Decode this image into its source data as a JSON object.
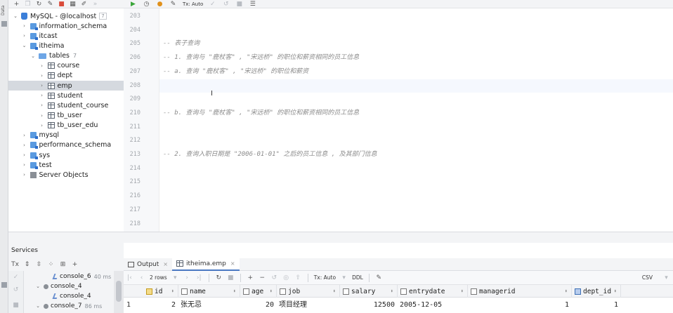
{
  "app": {
    "strip_label": "Data",
    "tree_toolbar_icons": [
      "add-icon",
      "copy-icon",
      "refresh-icon",
      "properties-icon",
      "stop-icon",
      "table-icon",
      "edit-icon",
      "back-icon"
    ],
    "editor_toolbar": {
      "tx_label": "Tx: Auto"
    }
  },
  "tree": [
    {
      "label": "MySQL - @localhost",
      "count": "7",
      "kind": "datasource",
      "expanded": true,
      "depth": 0
    },
    {
      "label": "information_schema",
      "kind": "schema",
      "expanded": false,
      "depth": 1
    },
    {
      "label": "itcast",
      "kind": "schema",
      "expanded": false,
      "depth": 1
    },
    {
      "label": "itheima",
      "kind": "schema",
      "expanded": true,
      "depth": 1
    },
    {
      "label": "tables",
      "count": "7",
      "kind": "folder",
      "expanded": true,
      "depth": 2
    },
    {
      "label": "course",
      "kind": "table",
      "depth": 3
    },
    {
      "label": "dept",
      "kind": "table",
      "depth": 3
    },
    {
      "label": "emp",
      "kind": "table",
      "depth": 3,
      "selected": true
    },
    {
      "label": "student",
      "kind": "table",
      "depth": 3
    },
    {
      "label": "student_course",
      "kind": "table",
      "depth": 3
    },
    {
      "label": "tb_user",
      "kind": "table",
      "depth": 3
    },
    {
      "label": "tb_user_edu",
      "kind": "table",
      "depth": 3
    },
    {
      "label": "mysql",
      "kind": "schema",
      "expanded": false,
      "depth": 1
    },
    {
      "label": "performance_schema",
      "kind": "schema",
      "expanded": false,
      "depth": 1
    },
    {
      "label": "sys",
      "kind": "schema",
      "expanded": false,
      "depth": 1
    },
    {
      "label": "test",
      "kind": "schema",
      "expanded": false,
      "depth": 1
    },
    {
      "label": "Server Objects",
      "kind": "server",
      "expanded": false,
      "depth": 1
    }
  ],
  "editor": {
    "lines": [
      {
        "number": "203",
        "text": ""
      },
      {
        "number": "204",
        "text": ""
      },
      {
        "number": "205",
        "text": "-- 表子查询"
      },
      {
        "number": "206",
        "text": "-- 1. 查询与 \"鹿杖客\" , \"宋远桥\" 的职位和薪资相同的员工信息"
      },
      {
        "number": "207",
        "text": "-- a. 查询 \"鹿杖客\" , \"宋远桥\" 的职位和薪资"
      },
      {
        "number": "208",
        "text": "",
        "current": true
      },
      {
        "number": "209",
        "text": ""
      },
      {
        "number": "210",
        "text": "-- b. 查询与 \"鹿杖客\" , \"宋远桥\" 的职位和薪资相同的员工信息"
      },
      {
        "number": "211",
        "text": ""
      },
      {
        "number": "212",
        "text": ""
      },
      {
        "number": "213",
        "text": "-- 2. 查询入职日期是 \"2006-01-01\" 之后的员工信息 , 及其部门信息"
      },
      {
        "number": "214",
        "text": ""
      },
      {
        "number": "215",
        "text": ""
      },
      {
        "number": "216",
        "text": ""
      },
      {
        "number": "217",
        "text": ""
      },
      {
        "number": "218",
        "text": ""
      }
    ]
  },
  "services": {
    "title": "Services",
    "tx_label": "Tx",
    "items": [
      {
        "label": "console_6",
        "ms": "40 ms",
        "kind": "console"
      },
      {
        "label": "console_4",
        "kind": "session"
      },
      {
        "label": "console_4",
        "kind": "console"
      },
      {
        "label": "console_7",
        "ms": "86 ms",
        "kind": "session"
      }
    ]
  },
  "results": {
    "tabs": [
      {
        "label": "Output",
        "active": false
      },
      {
        "label": "itheima.emp",
        "active": true
      }
    ],
    "rows_label": "2 rows",
    "tx_label": "Tx: Auto",
    "ddl_label": "DDL",
    "csv_label": "CSV",
    "columns": [
      {
        "name": "id",
        "kind": "key"
      },
      {
        "name": "name",
        "kind": "col"
      },
      {
        "name": "age",
        "kind": "col"
      },
      {
        "name": "job",
        "kind": "col"
      },
      {
        "name": "salary",
        "kind": "col"
      },
      {
        "name": "entrydate",
        "kind": "col"
      },
      {
        "name": "managerid",
        "kind": "col"
      },
      {
        "name": "dept_id",
        "kind": "fk"
      }
    ],
    "rows": [
      {
        "rownum": "1",
        "id": "2",
        "name": "张无忌",
        "age": "20",
        "job": "项目经理",
        "salary": "12500",
        "entrydate": "2005-12-05",
        "managerid": "1",
        "dept_id": "1"
      }
    ]
  }
}
